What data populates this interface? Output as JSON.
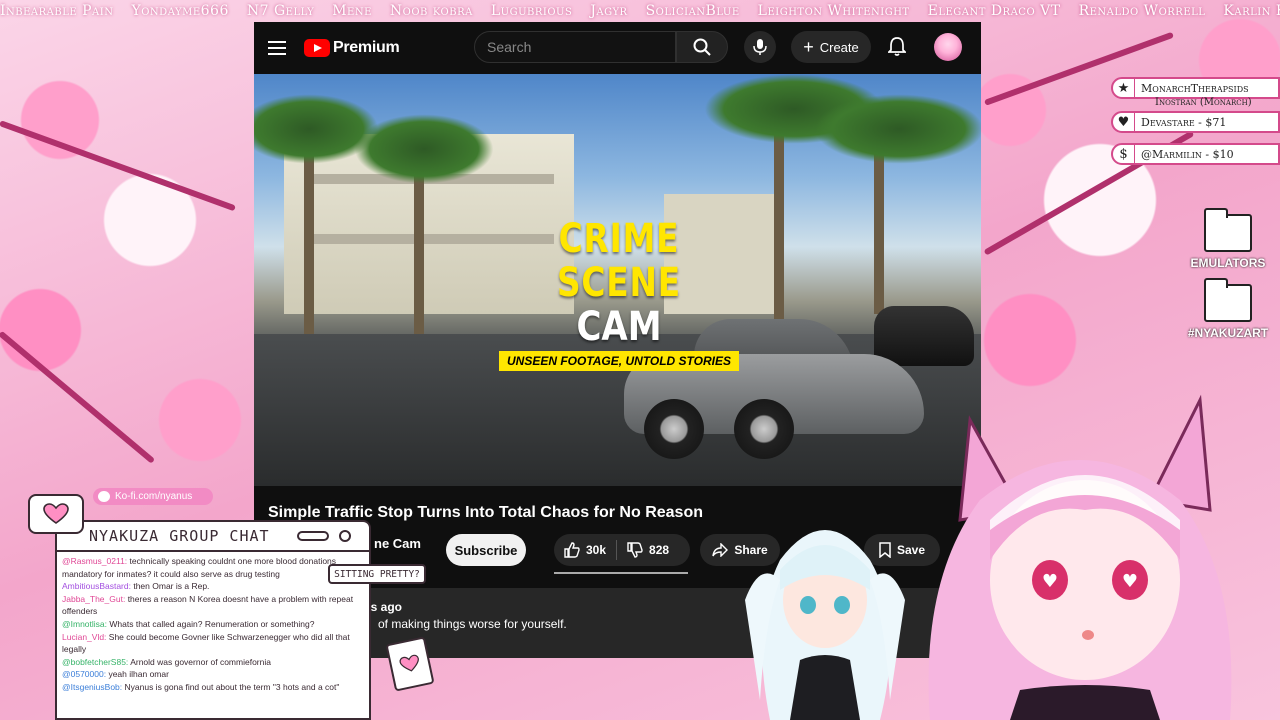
{
  "ticker": [
    "Inbearable Pain",
    "Yondayme666",
    "N7 Gelly",
    "Mene",
    "Noob kobra",
    "Lugubrious",
    "Jagyr",
    "SolicianBlue",
    "Leighton Whitenight",
    "Elegant Draco VT",
    "Renaldo Worrell",
    "Karlin Kalyn"
  ],
  "youtube": {
    "logo": "Premium",
    "search_placeholder": "Search",
    "create_label": "Create",
    "video_title": "Simple Traffic Stop Turns Into Total Chaos for No Reason",
    "channel_fragment": "ne Cam",
    "subscribe_label": "Subscribe",
    "likes": "30k",
    "dislikes": "828",
    "share_label": "Share",
    "save_label": "Save",
    "age_fragment": "rs ago",
    "desc_fragment": "of making things worse for yourself.",
    "thumb_line1": "CRIME SCENE",
    "thumb_line2": "CAM",
    "thumb_tagline": "UNSEEN FOOTAGE, UNTOLD STORIES"
  },
  "supporters": [
    {
      "icon": "star-icon",
      "text": "MonarchTherapsids"
    },
    {
      "icon": "heart-icon",
      "text": "Devastare - $71"
    },
    {
      "icon": "dollar-icon",
      "text": "@Marmilin - $10"
    }
  ],
  "supporter_sub": "Inostran (Monarch)",
  "folders": [
    {
      "label": "EMULATORS"
    },
    {
      "label": "#NYAKUZART"
    }
  ],
  "kofi_link": "Ko-fi.com/nyanus",
  "chat": {
    "title": "NYAKUZA GROUP CHAT",
    "messages": [
      {
        "user": "@Rasmus_0211:",
        "cls": "",
        "text": " technically speaking couldnt one more blood donations mandatory for inmates? it could also serve as drug testing"
      },
      {
        "user": "AmbitiousBastard:",
        "cls": "p",
        "text": " then Omar is a Rep."
      },
      {
        "user": "Jabba_The_Gut:",
        "cls": "",
        "text": " theres a reason N Korea doesnt have a problem with repeat offenders"
      },
      {
        "user": "@Imnotlisa:",
        "cls": "g",
        "text": " Whats that called again? Renumeration or something?"
      },
      {
        "user": "Lucian_Vld:",
        "cls": "",
        "text": " She could become Govner like Schwarzenegger who did all that legally"
      },
      {
        "user": "@bobfetcherS85:",
        "cls": "g",
        "text": " Arnold was governor of commiefornia"
      },
      {
        "user": "@0570000:",
        "cls": "b",
        "text": " yeah ilhan omar"
      },
      {
        "user": "@ItsgeniusBob:",
        "cls": "b",
        "text": " Nyanus is gona find out about the term \"3 hots and a cot\""
      }
    ]
  },
  "sitting_pretty": "SITTING PRETTY?",
  "colors": {
    "accent_pink": "#d44a8b",
    "yt_red": "#ff0000",
    "yt_bg": "#0f0f0f",
    "thumb_yellow": "#ffe600"
  }
}
